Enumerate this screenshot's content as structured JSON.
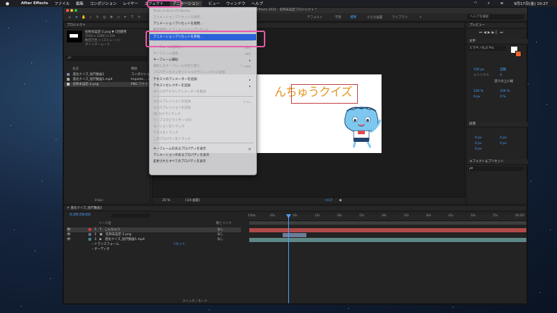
{
  "menubar": {
    "app_name": "After Effects",
    "items": [
      "ファイル",
      "編集",
      "コンポジション",
      "レイヤー",
      "エフェクト",
      "アニメーション",
      "ビュー",
      "ウィンドウ",
      "ヘルプ"
    ],
    "clock": "9月17日(金) 10:27",
    "active_item": "アニメーション"
  },
  "window": {
    "title": "Adobe After Effects 2021 - 名称未設定プロジェクト *",
    "workspaces": [
      "デフォルト",
      "学習",
      "標準",
      "小さな画面",
      "ライブラリ"
    ],
    "help_search": "ヘルプを検索"
  },
  "project_panel": {
    "title": "プロジェクト",
    "selected_name": "名称未設定-2.png ▼ 1回使用",
    "selected_info1": "1920 x 1080 (1.00)",
    "selected_info2": "数百万色 + (ストレート)",
    "selected_info3": "ポインタームース",
    "search_placeholder": "ρ▾",
    "col_name": "名前",
    "col_type": "種類",
    "items": [
      {
        "name": "進化クイズ_短尺動画1",
        "type": "コンポジショ"
      },
      {
        "name": "進化クイズ_短尺動画1.mp4",
        "type": "Importe..., E"
      },
      {
        "name": "名称未設定-2.png",
        "type": "PNG ファイ"
      }
    ],
    "bpc": "8 bpc"
  },
  "animation_menu": {
    "items": [
      {
        "label": "Track in Boris FX Mocha",
        "disabled": true,
        "shortcut": ""
      },
      {
        "label": "アニメーションプリセットを保存...",
        "disabled": true,
        "shortcut": ""
      },
      {
        "label": "アニメーションプリセットを適用...",
        "disabled": false,
        "shortcut": ""
      },
      {
        "label": "最近使用したアニメーションプリセット",
        "disabled": true,
        "shortcut": "▸"
      },
      {
        "label": "アニメーションプリセットを参照...",
        "disabled": false,
        "shortcut": "",
        "highlighted": true
      },
      {
        "label": "キーフレーム補間法...",
        "disabled": true,
        "shortcut": "⌥⌘K"
      },
      {
        "label": "キーフレーム速度...",
        "disabled": true,
        "shortcut": "⇧⌘K"
      },
      {
        "label": "キーフレーム補助",
        "disabled": false,
        "shortcut": "▸"
      },
      {
        "label": "選択したキーフレームの切り替え",
        "disabled": true,
        "shortcut": "^⌥⌘H"
      },
      {
        "label": "キーフレーム補間法...",
        "disabled": true,
        "shortcut": "⌥⌘K"
      },
      {
        "label": "キーフレーム速度...",
        "disabled": true,
        "shortcut": "⇧⌘K"
      },
      {
        "label": "キーフレーム補助",
        "disabled": false,
        "shortcut": "▸"
      },
      {
        "label": "プロパティをエッセンシャルグラフィックスに追加",
        "disabled": true,
        "shortcut": ""
      },
      {
        "label": "テキストのアニメーターを追加",
        "disabled": false,
        "shortcut": "▸"
      },
      {
        "label": "テキストセレクターを追加",
        "disabled": false,
        "shortcut": "▸"
      },
      {
        "label": "すべてのテキストアニメーターを削除",
        "disabled": true,
        "shortcut": ""
      },
      {
        "label": "エクスプレッションを追加",
        "disabled": true,
        "shortcut": "⇧⌥="
      },
      {
        "label": "エクスプレッションを追加",
        "disabled": true,
        "shortcut": ""
      },
      {
        "label": "3D カメラトラック",
        "disabled": true,
        "shortcut": ""
      },
      {
        "label": "ワープスタビライザー VFX",
        "disabled": true,
        "shortcut": ""
      },
      {
        "label": "モーションをトラック",
        "disabled": true,
        "shortcut": ""
      },
      {
        "label": "マスクをトラック",
        "disabled": true,
        "shortcut": ""
      },
      {
        "label": "このプロパティをトラック",
        "disabled": true,
        "shortcut": ""
      },
      {
        "label": "キーフレームのあるプロパティを表示",
        "disabled": false,
        "shortcut": "U"
      },
      {
        "label": "アニメーションのあるプロパティを表示",
        "disabled": false,
        "shortcut": ""
      },
      {
        "label": "変更されたすべてのプロパティを表示",
        "disabled": false,
        "shortcut": ""
      }
    ]
  },
  "viewer": {
    "title_text": "んちゅうクイズ",
    "zoom": "25 %",
    "resolution": "(1/4 画質)",
    "exposure": "+0.0"
  },
  "right_panel": {
    "preview_title": "プレビュー",
    "text_title": "文字",
    "font_name": "ヒラギノ丸ゴ Pro",
    "font_size": "100 px",
    "tracking": "0",
    "scale_v": "100 %",
    "scale_h": "100 %",
    "baseline": "0 px",
    "tsume": "0 %",
    "auto_label": "自動",
    "metrics_label": "メトリクス",
    "stroke_label": "塗りの上に線",
    "paragraph_title": "段落",
    "para_values": [
      "0 px",
      "0 px",
      "0 px",
      "0 px",
      "0 px"
    ],
    "effects_title": "エフェクト＆プリセット",
    "effects_search": "ρ▾"
  },
  "timeline": {
    "comp_name": "進化クイズ_短尺動画1",
    "timecode": "0;00;09;00",
    "fps_label": "0:00:09:00 (29.97 fps)",
    "col_source": "ソース名",
    "col_parent": "親とリンク",
    "ruler": [
      "0:00s",
      "05s",
      "10s",
      "15s",
      "20s",
      "25s",
      "30s",
      "35s",
      "40s",
      "45s",
      "50s",
      "55s",
      "00:02f"
    ],
    "layers": [
      {
        "num": "1",
        "name": "こんちゅう",
        "parent": "なし",
        "color": "#cf3b3b",
        "icon": "T"
      },
      {
        "num": "2",
        "name": "名称未設定-2.png",
        "parent": "なし",
        "color": "#5b6f8f",
        "icon": "▣"
      },
      {
        "num": "3",
        "name": "進化クイズ_短尺動画1.mp4",
        "parent": "なし",
        "color": "#3b8c8c",
        "icon": "▶"
      }
    ],
    "sub_transform": "トランスフォーム",
    "sub_transform_reset": "リセット",
    "sub_audio": "オーディオ",
    "switch_mode": "スイッチ / モード"
  }
}
